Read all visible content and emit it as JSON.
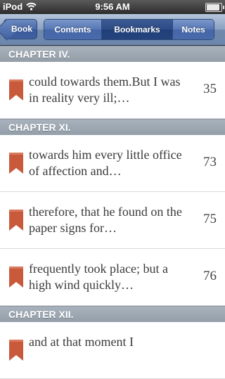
{
  "status_bar": {
    "carrier": "iPod",
    "time": "9:56 AM"
  },
  "nav": {
    "back_label": "Book",
    "tabs": [
      {
        "label": "Contents",
        "active": false
      },
      {
        "label": "Bookmarks",
        "active": true
      },
      {
        "label": "Notes",
        "active": false
      }
    ]
  },
  "sections": [
    {
      "header": "CHAPTER IV.",
      "rows": [
        {
          "excerpt": "could towards them.But I was in reality very ill;…",
          "page": "35"
        }
      ]
    },
    {
      "header": "CHAPTER XI.",
      "rows": [
        {
          "excerpt": "towards him every little office of affection and…",
          "page": "73"
        },
        {
          "excerpt": "therefore, that he found on the paper signs for…",
          "page": "75"
        },
        {
          "excerpt": "frequently took place; but a high wind quickly…",
          "page": "76"
        }
      ]
    },
    {
      "header": "CHAPTER XII.",
      "rows": [
        {
          "excerpt": "and at that moment I",
          "page": ""
        }
      ]
    }
  ],
  "colors": {
    "bookmark": "#c8593a",
    "nav_active": "#25437c"
  },
  "icons": {
    "bookmark": "bookmark-ribbon-icon",
    "wifi": "wifi-icon",
    "battery": "battery-icon"
  }
}
